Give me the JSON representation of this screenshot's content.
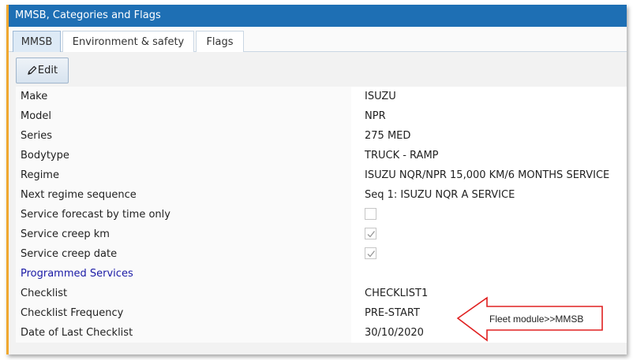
{
  "window": {
    "title": "MMSB, Categories and Flags"
  },
  "tabs": [
    {
      "label": "MMSB",
      "active": true
    },
    {
      "label": "Environment & safety",
      "active": false
    },
    {
      "label": "Flags",
      "active": false
    }
  ],
  "toolbar": {
    "edit_label": "Edit",
    "edit_icon": "pencil-icon"
  },
  "rows": [
    {
      "label": "Make",
      "value": "ISUZU"
    },
    {
      "label": "Model",
      "value": "NPR"
    },
    {
      "label": "Series",
      "value": "275 MED"
    },
    {
      "label": "Bodytype",
      "value": "TRUCK - RAMP"
    },
    {
      "label": "Regime",
      "value": "ISUZU NQR/NPR 15,000 KM/6 MONTHS SERVICE"
    },
    {
      "label": "Next regime sequence",
      "value": "Seq 1: ISUZU NQR A SERVICE"
    },
    {
      "label": "Service forecast by time only",
      "checked": false
    },
    {
      "label": "Service creep km",
      "checked": true
    },
    {
      "label": "Service creep date",
      "checked": true
    },
    {
      "label": "Programmed Services"
    },
    {
      "label": "Checklist",
      "value": "CHECKLIST1"
    },
    {
      "label": "Checklist Frequency",
      "value": "PRE-START"
    },
    {
      "label": "Date of Last Checklist",
      "value": "30/10/2020"
    }
  ],
  "annotation": {
    "text": "Fleet module>>MMSB",
    "color": "#e02020"
  },
  "colors": {
    "titlebar": "#1e6fb4",
    "accent_border": "#f0a830",
    "link": "#1a1aa6"
  }
}
